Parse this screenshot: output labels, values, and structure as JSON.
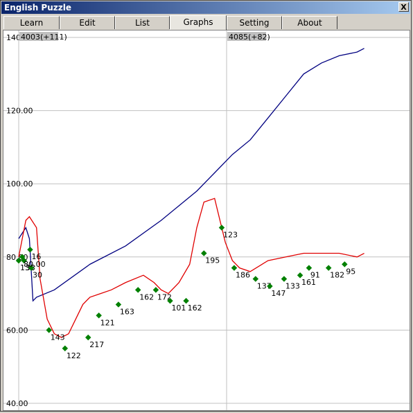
{
  "window": {
    "title": "English Puzzle",
    "close_label": "X"
  },
  "tabs": [
    {
      "label": "Learn",
      "active": false
    },
    {
      "label": "Edit",
      "active": false
    },
    {
      "label": "List",
      "active": false
    },
    {
      "label": "Graphs",
      "active": true
    },
    {
      "label": "Setting",
      "active": false
    },
    {
      "label": "About",
      "active": false
    }
  ],
  "colors": {
    "blue_series": "#000080",
    "red_series": "#e00000",
    "markers": "#008000",
    "grid": "#c0c0c0"
  },
  "chart_data": {
    "type": "line",
    "cursor_labels": [
      "4003(+111)",
      "4085(+82)"
    ],
    "y_tick_labels": [
      "140.00",
      "120.00",
      "100.00",
      "80.00",
      "60.00",
      "40.00"
    ],
    "ylim": [
      40,
      140
    ],
    "xlim": [
      0,
      100
    ],
    "series": [
      {
        "name": "",
        "color": "#000080",
        "x": [
          0,
          2,
          3,
          4,
          5,
          10,
          20,
          30,
          40,
          45,
          50,
          55,
          60,
          65,
          70,
          75,
          80,
          85,
          90,
          95,
          97
        ],
        "y": [
          85,
          88,
          85,
          68,
          69,
          71,
          78,
          83,
          90,
          94,
          98,
          103,
          108,
          112,
          118,
          124,
          130,
          133,
          135,
          136,
          137
        ]
      },
      {
        "name": "",
        "color": "#e00000",
        "x": [
          0,
          2,
          3,
          5,
          6,
          8,
          10,
          12,
          14,
          16,
          18,
          20,
          23,
          26,
          30,
          35,
          38,
          40,
          42,
          45,
          48,
          50,
          52,
          55,
          58,
          60,
          62,
          65,
          70,
          75,
          80,
          85,
          90,
          95,
          97
        ],
        "y": [
          80,
          90,
          91,
          88,
          74,
          63,
          59,
          58,
          59,
          63,
          67,
          69,
          70,
          71,
          73,
          75,
          73,
          71,
          70,
          73,
          78,
          88,
          95,
          96,
          84,
          79,
          77,
          76,
          79,
          80,
          81,
          81,
          81,
          80,
          81
        ]
      }
    ],
    "point_labels": [
      {
        "x": 0,
        "y": 79,
        "text": "131"
      },
      {
        "x": 1.5,
        "y": 79,
        "text": "38"
      },
      {
        "x": 3.2,
        "y": 82,
        "text": "16"
      },
      {
        "x": 3.5,
        "y": 77,
        "text": "30"
      },
      {
        "x": 1,
        "y": 80,
        "text": "80.00"
      },
      {
        "x": 8.5,
        "y": 60,
        "text": "143"
      },
      {
        "x": 13,
        "y": 55,
        "text": "122"
      },
      {
        "x": 19.5,
        "y": 58,
        "text": "217"
      },
      {
        "x": 22.5,
        "y": 64,
        "text": "121"
      },
      {
        "x": 28,
        "y": 67,
        "text": "163"
      },
      {
        "x": 33.5,
        "y": 71,
        "text": "162"
      },
      {
        "x": 38.5,
        "y": 71,
        "text": "172"
      },
      {
        "x": 42.5,
        "y": 68,
        "text": "101"
      },
      {
        "x": 47,
        "y": 68,
        "text": "162"
      },
      {
        "x": 52,
        "y": 81,
        "text": "195"
      },
      {
        "x": 57,
        "y": 88,
        "text": "123"
      },
      {
        "x": 60.5,
        "y": 77,
        "text": "186"
      },
      {
        "x": 66.5,
        "y": 74,
        "text": "137"
      },
      {
        "x": 70.5,
        "y": 72,
        "text": "147"
      },
      {
        "x": 74.5,
        "y": 74,
        "text": "133"
      },
      {
        "x": 79,
        "y": 75,
        "text": "161"
      },
      {
        "x": 81.5,
        "y": 77,
        "text": "91"
      },
      {
        "x": 87,
        "y": 77,
        "text": "182"
      },
      {
        "x": 91.5,
        "y": 78,
        "text": "95"
      }
    ],
    "grid": true
  }
}
